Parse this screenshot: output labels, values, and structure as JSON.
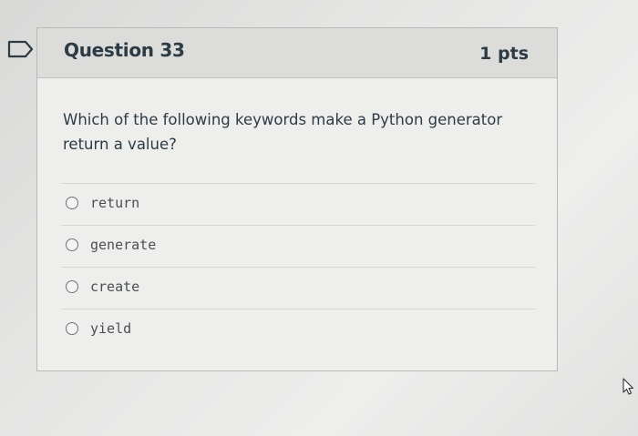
{
  "question": {
    "title": "Question 33",
    "points": "1 pts",
    "text": "Which of the following keywords make a Python generator return a value?",
    "options": [
      {
        "label": "return"
      },
      {
        "label": "generate"
      },
      {
        "label": "create"
      },
      {
        "label": "yield"
      }
    ]
  },
  "icons": {
    "flag": "bookmark-flag-icon",
    "cursor": "mouse-cursor-icon"
  },
  "colors": {
    "text": "#2d3b45",
    "header_bg": "#dcdcdb",
    "card_bg": "#eeeeed"
  }
}
